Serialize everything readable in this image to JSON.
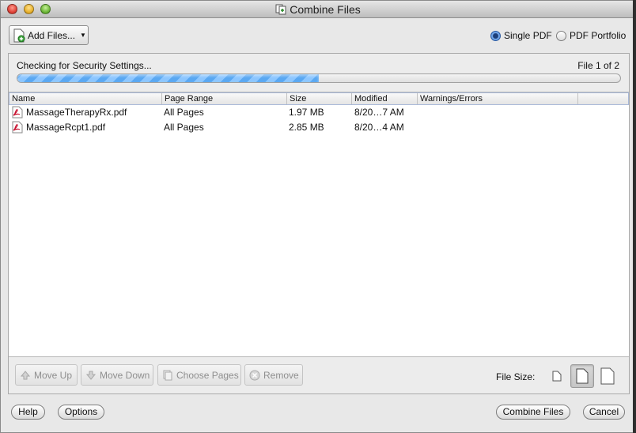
{
  "window": {
    "title": "Combine Files"
  },
  "toolbar": {
    "add_files_label": "Add Files...",
    "add_files_caret": "▼"
  },
  "output_mode": {
    "single_pdf_label": "Single PDF",
    "pdf_portfolio_label": "PDF Portfolio",
    "selected": "Single PDF"
  },
  "status": {
    "message": "Checking for Security Settings...",
    "file_count": "File 1 of 2",
    "progress_fraction": 0.5
  },
  "table": {
    "columns": [
      "Name",
      "Page Range",
      "Size",
      "Modified",
      "Warnings/Errors"
    ],
    "rows": [
      {
        "name": "MassageTherapyRx.pdf",
        "page_range": "All Pages",
        "size": "1.97 MB",
        "modified": "8/20…7 AM",
        "warnings": ""
      },
      {
        "name": "MassageRcpt1.pdf",
        "page_range": "All Pages",
        "size": "2.85 MB",
        "modified": "8/20…4 AM",
        "warnings": ""
      }
    ]
  },
  "list_actions": {
    "move_up": "Move Up",
    "move_down": "Move Down",
    "choose_pages": "Choose Pages",
    "remove": "Remove"
  },
  "file_size": {
    "label": "File Size:",
    "options": [
      "small-file-icon",
      "default-file-icon",
      "large-file-icon"
    ],
    "selected_index": 1
  },
  "footer": {
    "help": "Help",
    "options": "Options",
    "combine": "Combine Files",
    "cancel": "Cancel"
  },
  "colors": {
    "progress": "#5aa8f2",
    "pdf_red": "#c8102e",
    "radio_selected": "#3d7fdc"
  }
}
